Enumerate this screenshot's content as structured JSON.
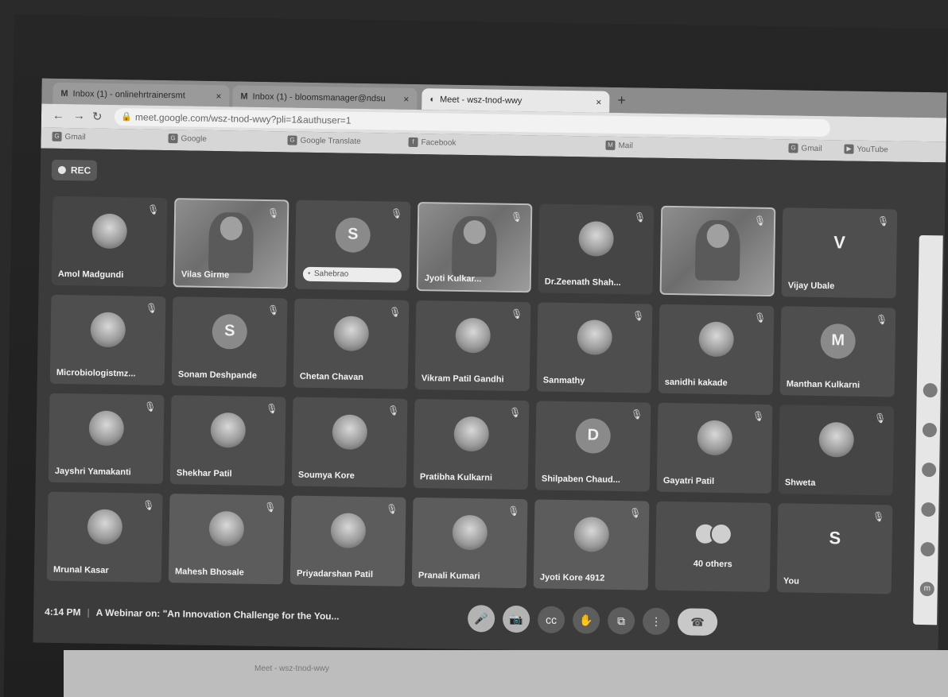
{
  "browser": {
    "tabs": [
      {
        "icon": "M",
        "label": "Inbox (1) - onlinehrtrainersmt",
        "close": "×"
      },
      {
        "icon": "M",
        "label": "Inbox (1) - bloomsmanager@ndsu",
        "close": "×"
      },
      {
        "icon": "meet",
        "label": "Meet - wsz-tnod-wwy",
        "close": "×"
      }
    ],
    "new_tab": "+",
    "url": "meet.google.com/wsz-tnod-wwy?pli=1&authuser=1",
    "bookmarks": [
      {
        "icon": "G",
        "label": "Gmail"
      },
      {
        "icon": "G",
        "label": "Google"
      },
      {
        "icon": "G",
        "label": "Google Translate"
      },
      {
        "icon": "f",
        "label": "Facebook"
      },
      {
        "icon": "M",
        "label": "Mail"
      },
      {
        "icon": "G",
        "label": "Gmail"
      },
      {
        "icon": "▶",
        "label": "YouTube"
      }
    ]
  },
  "meet": {
    "rec_label": "REC",
    "participants": [
      {
        "name": "Amol Madgundi",
        "avatar": "",
        "style": "dark"
      },
      {
        "name": "Vilas Girme",
        "avatar": "",
        "style": "video"
      },
      {
        "name": "Sahebrao",
        "avatar": "S",
        "style": "pill"
      },
      {
        "name": "Jyoti Kulkar...",
        "avatar": "",
        "style": "video"
      },
      {
        "name": "Dr.Zeenath Shah...",
        "avatar": "",
        "style": "dark"
      },
      {
        "name": "",
        "avatar": "",
        "style": "video"
      },
      {
        "name": "Vijay Ubale",
        "avatar": "V",
        "style": "letter"
      },
      {
        "name": "Microbiologistmz...",
        "avatar": "",
        "style": "photo"
      },
      {
        "name": "Sonam Deshpande",
        "avatar": "S",
        "style": "initial"
      },
      {
        "name": "Chetan Chavan",
        "avatar": "",
        "style": "photo"
      },
      {
        "name": "Vikram Patil Gandhi",
        "avatar": "",
        "style": "photo"
      },
      {
        "name": "Sanmathy",
        "avatar": "",
        "style": "photo"
      },
      {
        "name": "sanidhi kakade",
        "avatar": "",
        "style": "photo"
      },
      {
        "name": "Manthan Kulkarni",
        "avatar": "M",
        "style": "initial"
      },
      {
        "name": "Jayshri Yamakanti",
        "avatar": "",
        "style": "photo"
      },
      {
        "name": "Shekhar Patil",
        "avatar": "",
        "style": "photo"
      },
      {
        "name": "Soumya Kore",
        "avatar": "",
        "style": "photo"
      },
      {
        "name": "Pratibha Kulkarni",
        "avatar": "",
        "style": "photo"
      },
      {
        "name": "Shilpaben Chaud...",
        "avatar": "D",
        "style": "initial"
      },
      {
        "name": "Gayatri Patil",
        "avatar": "",
        "style": "photo"
      },
      {
        "name": "Shweta",
        "avatar": "",
        "style": "dark"
      },
      {
        "name": "Mrunal Kasar",
        "avatar": "",
        "style": "photo"
      },
      {
        "name": "Mahesh Bhosale",
        "avatar": "",
        "style": "light"
      },
      {
        "name": "Priyadarshan Patil",
        "avatar": "",
        "style": "light"
      },
      {
        "name": "Pranali Kumari",
        "avatar": "",
        "style": "light"
      },
      {
        "name": "Jyoti Kore 4912",
        "avatar": "",
        "style": "light"
      },
      {
        "name": "40 others",
        "avatar": "",
        "style": "others"
      },
      {
        "name": "You",
        "avatar": "S",
        "style": "letter"
      }
    ],
    "time": "4:14 PM",
    "meeting_title": "A Webinar on: \"An Innovation Challenge for the You...",
    "controls": [
      {
        "name": "mic-button",
        "icon": "mic-icon",
        "glyph": "🎤"
      },
      {
        "name": "camera-button",
        "icon": "camera-icon",
        "glyph": "📷"
      },
      {
        "name": "captions-button",
        "icon": "captions-icon",
        "glyph": "cc"
      },
      {
        "name": "raise-hand-button",
        "icon": "hand-icon",
        "glyph": "✋"
      },
      {
        "name": "present-button",
        "icon": "present-icon",
        "glyph": "⧉"
      },
      {
        "name": "more-options-button",
        "icon": "more-vert-icon",
        "glyph": "⋮"
      },
      {
        "name": "leave-call-button",
        "icon": "phone-hangup-icon",
        "glyph": "☎"
      }
    ],
    "side_panel_dots": [
      "",
      "",
      "",
      "",
      "",
      "m"
    ]
  },
  "taskbar": {
    "items": [
      "",
      "Meet - wsz-tnod-wwy"
    ]
  }
}
